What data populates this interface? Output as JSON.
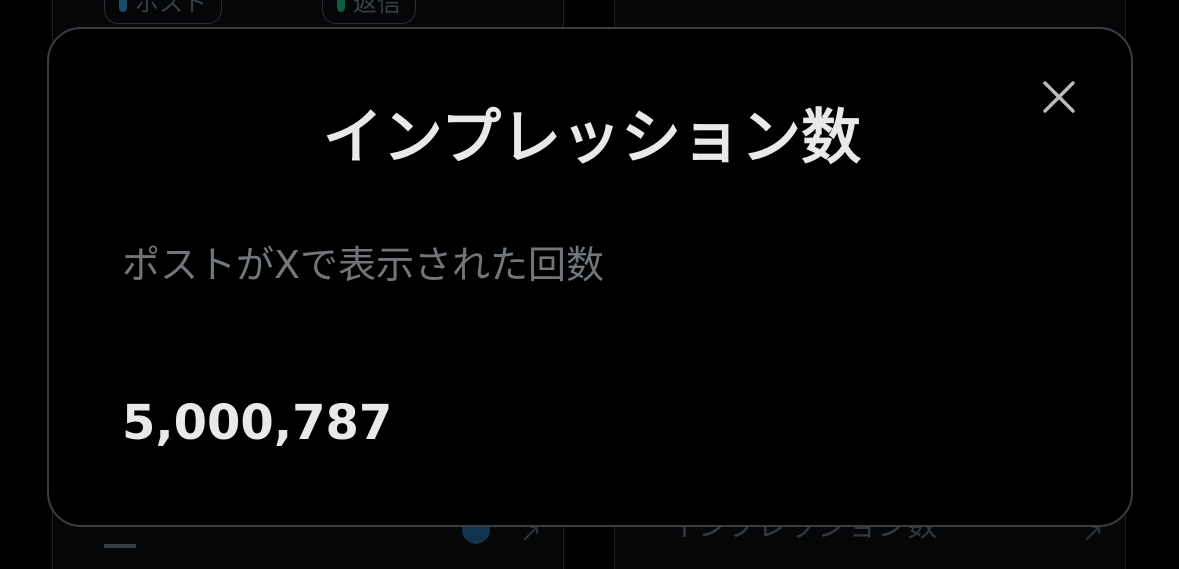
{
  "background": {
    "chips": [
      {
        "label": "ポスト",
        "dot_color": "#1d9bf0"
      },
      {
        "label": "返信",
        "dot_color": "#00ba7c"
      }
    ],
    "metric_label": "インプレッション数"
  },
  "modal": {
    "title": "インプレッション数",
    "description": "ポストがXで表示された回数",
    "value": "5,000,787",
    "close_icon": "close-icon"
  },
  "colors": {
    "background": "#000000",
    "modal_border": "#3a3d41",
    "primary_text": "#e7e9ea",
    "secondary_text": "#71767b"
  }
}
